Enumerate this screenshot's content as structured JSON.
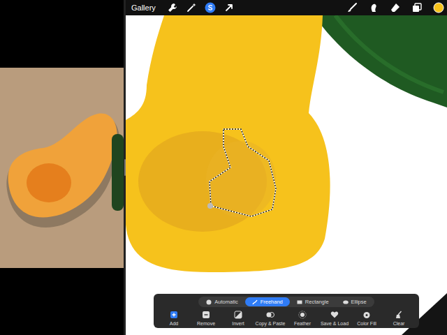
{
  "top_bar": {
    "gallery": "Gallery",
    "left_tools": [
      {
        "kind": "wrench",
        "selected": false
      },
      {
        "kind": "wand",
        "selected": false
      },
      {
        "kind": "selection",
        "selected": true
      },
      {
        "kind": "transform",
        "selected": false
      }
    ],
    "right_tools": [
      {
        "kind": "brush",
        "selected": false
      },
      {
        "kind": "smudge",
        "selected": false
      },
      {
        "kind": "eraser",
        "selected": false
      },
      {
        "kind": "layers",
        "selected": false
      },
      {
        "kind": "color",
        "selected": false
      }
    ]
  },
  "selection_modes": [
    {
      "label": "Automatic",
      "kind": "automatic",
      "selected": false
    },
    {
      "label": "Freehand",
      "kind": "freehand",
      "selected": true
    },
    {
      "label": "Rectangle",
      "kind": "rectangle",
      "selected": false
    },
    {
      "label": "Ellipse",
      "kind": "ellipse",
      "selected": false
    }
  ],
  "actions": [
    {
      "label": "Add",
      "kind": "add",
      "selected": true
    },
    {
      "label": "Remove",
      "kind": "remove",
      "selected": false
    },
    {
      "label": "Invert",
      "kind": "invert",
      "selected": false
    },
    {
      "label": "Copy & Paste",
      "kind": "copy",
      "selected": false
    },
    {
      "label": "Feather",
      "kind": "feather",
      "selected": false
    },
    {
      "label": "Save & Load",
      "kind": "save",
      "selected": false
    },
    {
      "label": "Color Fill",
      "kind": "fill",
      "selected": false
    },
    {
      "label": "Clear",
      "kind": "clear",
      "selected": false
    }
  ]
}
